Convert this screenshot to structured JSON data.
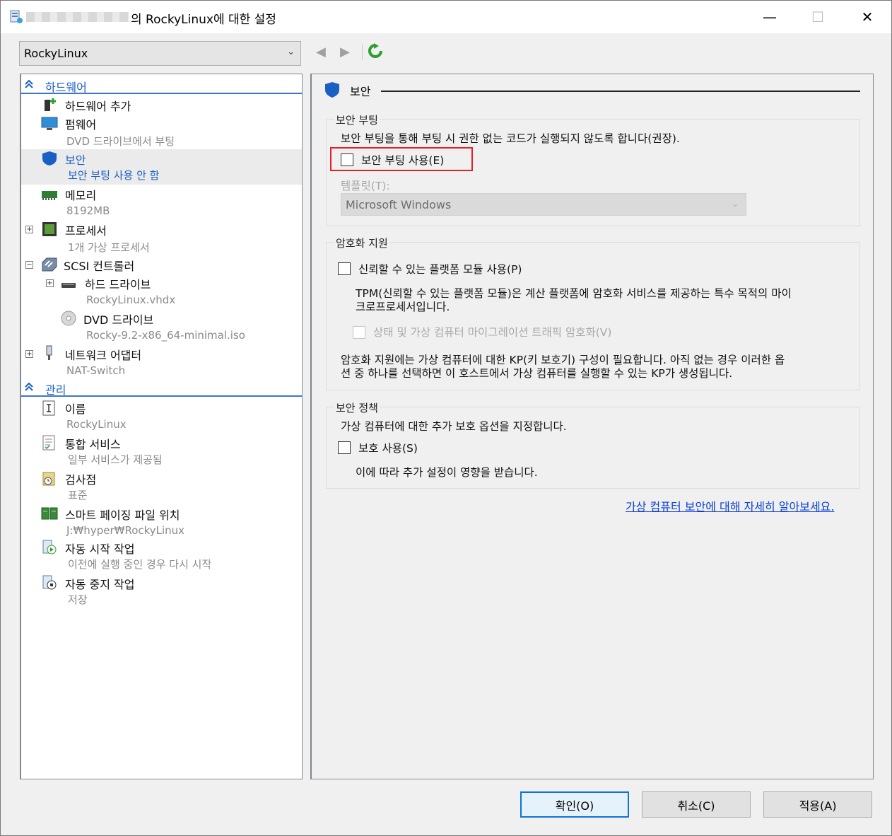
{
  "titlebar": {
    "title": "의 RockyLinux에 대한 설정",
    "minimize": "—",
    "maximize": "☐",
    "close": "✕"
  },
  "vm_select": {
    "value": "RockyLinux"
  },
  "toolbar": {
    "back": "◀",
    "forward": "▶"
  },
  "sidebar": {
    "hardware_section": "하드웨어",
    "hardware_items": [
      {
        "name": "하드웨어 추가",
        "sub": ""
      },
      {
        "name": "펌웨어",
        "sub": "DVD 드라이브에서 부팅"
      },
      {
        "name": "보안",
        "sub": "보안 부팅 사용 안 함"
      },
      {
        "name": "메모리",
        "sub": "8192MB"
      },
      {
        "name": "프로세서",
        "sub": "1개 가상 프로세서"
      },
      {
        "name": "SCSI 컨트롤러",
        "sub": ""
      },
      {
        "name": "하드 드라이브",
        "sub": "RockyLinux.vhdx"
      },
      {
        "name": "DVD 드라이브",
        "sub": "Rocky-9.2-x86_64-minimal.iso"
      },
      {
        "name": "네트워크 어댑터",
        "sub": "NAT-Switch"
      }
    ],
    "management_section": "관리",
    "management_items": [
      {
        "name": "이름",
        "sub": "RockyLinux"
      },
      {
        "name": "통합 서비스",
        "sub": "일부 서비스가 제공됨"
      },
      {
        "name": "검사점",
        "sub": "표준"
      },
      {
        "name": "스마트 페이징 파일 위치",
        "sub": "J:₩hyper₩RockyLinux"
      },
      {
        "name": "자동 시작 작업",
        "sub": "이전에 실행 중인 경우 다시 시작"
      },
      {
        "name": "자동 중지 작업",
        "sub": "저장"
      }
    ]
  },
  "main": {
    "title": "보안",
    "secure_boot": {
      "group": "보안 부팅",
      "desc": "보안 부팅을 통해 부팅 시 권한 없는 코드가 실행되지 않도록 합니다(권장).",
      "checkbox": "보안 부팅 사용(E)",
      "checked": false,
      "template_label": "템플릿(T):",
      "template_value": "Microsoft Windows"
    },
    "encryption": {
      "group": "암호화 지원",
      "tpm_checkbox": "신뢰할 수 있는 플랫폼 모듈 사용(P)",
      "tpm_desc_1": "TPM(신뢰할 수 있는 플랫폼 모듈)은 계산 플랫폼에 암호화 서비스를 제공하는 특수 목적의 마이",
      "tpm_desc_2": "크로프로세서입니다.",
      "migration_checkbox": "상태 및 가상 컴퓨터 마이그레이션 트래픽 암호화(V)",
      "kp_desc_1": "암호화 지원에는 가상 컴퓨터에 대한 KP(키 보호기) 구성이 필요합니다. 아직 없는 경우 이러한 옵",
      "kp_desc_2": "션 중 하나를 선택하면 이 호스트에서 가상 컴퓨터를 실행할 수 있는 KP가 생성됩니다."
    },
    "policy": {
      "group": "보안 정책",
      "desc": "가상 컴퓨터에 대한 추가 보호 옵션을 지정합니다.",
      "checkbox": "보호 사용(S)",
      "note": "이에 따라 추가 설정이 영향을 받습니다."
    },
    "learn_more": "가상 컴퓨터 보안에 대해 자세히 알아보세요."
  },
  "buttons": {
    "ok": "확인(O)",
    "cancel": "취소(C)",
    "apply": "적용(A)"
  },
  "colors": {
    "accent": "#1a5fc4",
    "highlight": "#e4202a",
    "link": "#0b40d6"
  }
}
